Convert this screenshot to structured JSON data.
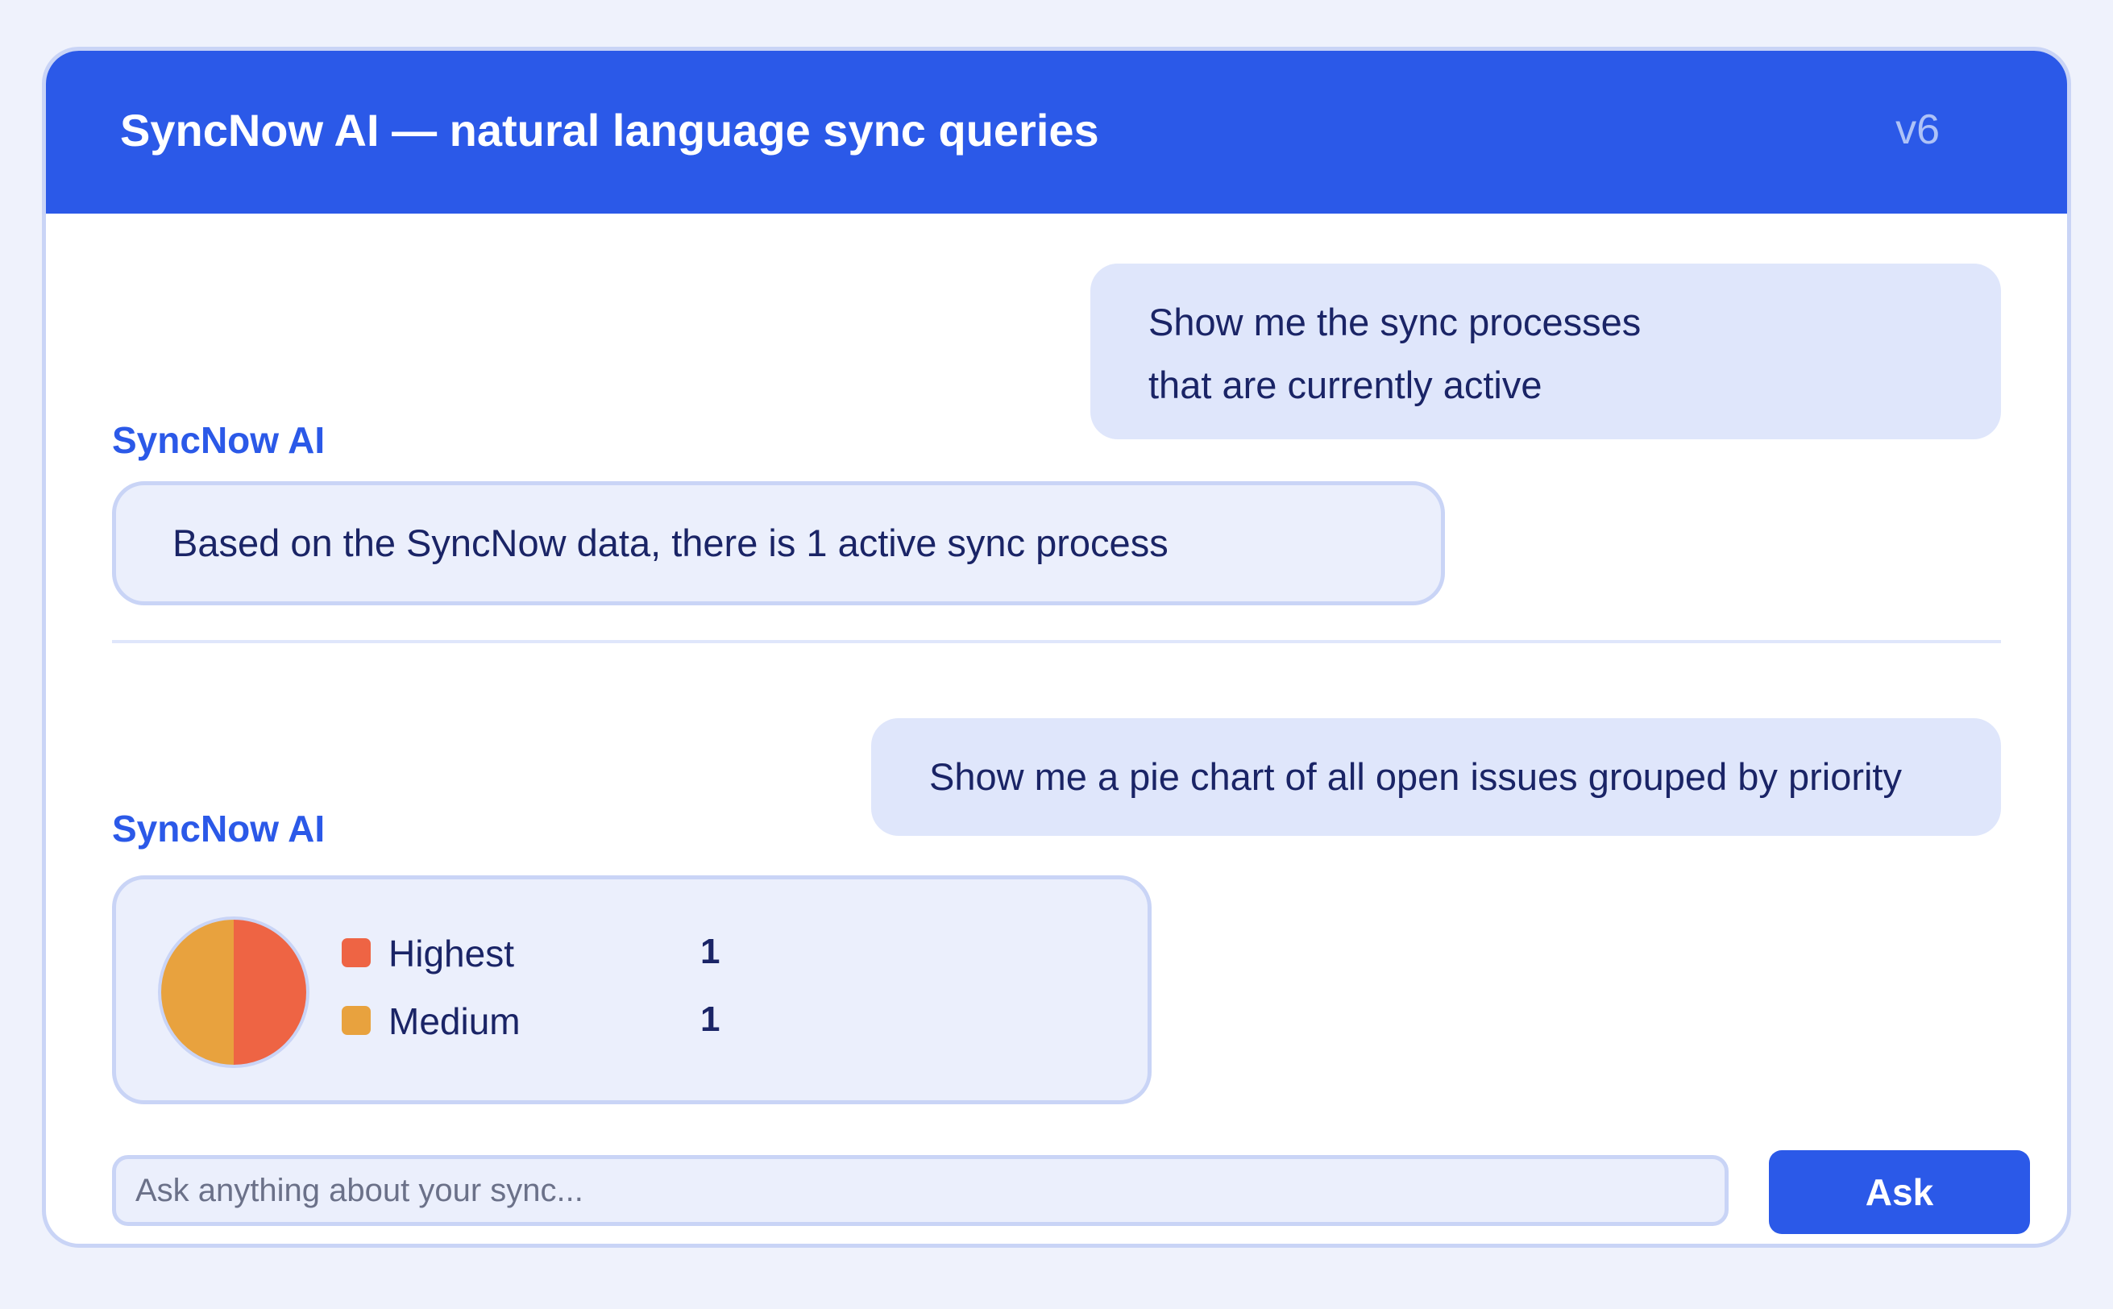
{
  "header": {
    "title": "SyncNow AI — natural language sync queries",
    "version": "v6"
  },
  "conversation": [
    {
      "user_lines": [
        "Show me the sync processes",
        "that are currently active"
      ],
      "assistant_name": "SyncNow AI",
      "assistant_text": "Based on the SyncNow data, there is 1 active sync process"
    },
    {
      "user_text": "Show me a pie chart of all open issues grouped by priority",
      "assistant_name": "SyncNow AI"
    }
  ],
  "chart_data": {
    "type": "pie",
    "categories": [
      "Highest",
      "Medium"
    ],
    "values": [
      1,
      1
    ],
    "colors": [
      "#ee6444",
      "#e8a23e"
    ]
  },
  "composer": {
    "placeholder": "Ask anything about your sync...",
    "value": "",
    "button_label": "Ask"
  },
  "colors": {
    "accent": "#2b59e8",
    "user_bubble": "#dfe6fb",
    "assistant_bubble": "#ebeffc"
  }
}
